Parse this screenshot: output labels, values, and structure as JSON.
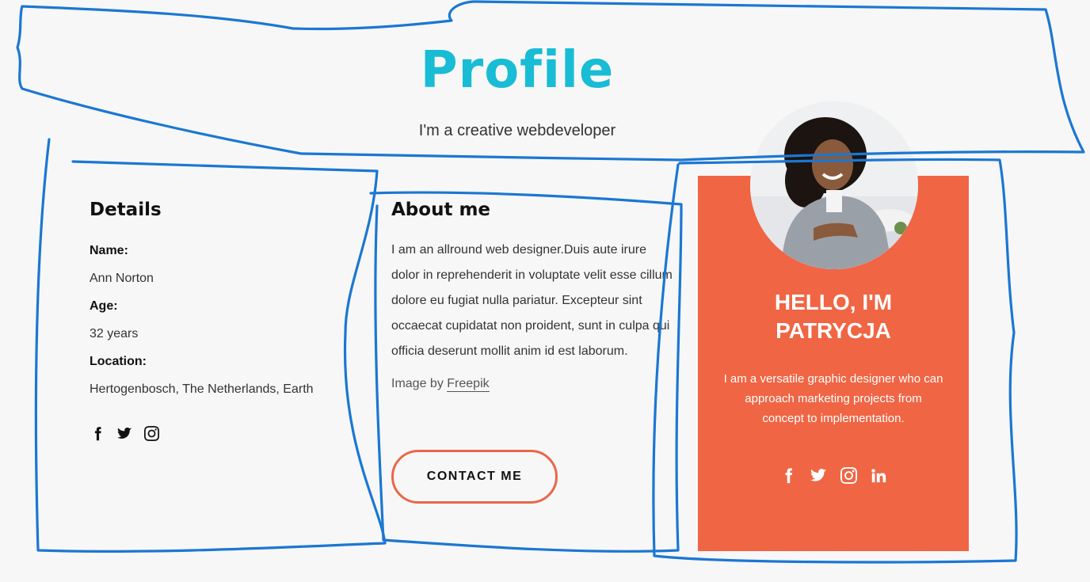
{
  "header": {
    "title": "Profile",
    "subtitle": "I'm a creative webdeveloper"
  },
  "details": {
    "heading": "Details",
    "name_label": "Name:",
    "name_value": "Ann Norton",
    "age_label": "Age:",
    "age_value": "32 years",
    "location_label": "Location:",
    "location_value": "Hertogenbosch, The Netherlands, Earth",
    "social_icons": [
      "facebook-icon",
      "twitter-icon",
      "instagram-icon"
    ]
  },
  "about": {
    "heading": "About me",
    "text": "I am an allround web designer.Duis aute irure dolor in reprehenderit in voluptate velit esse cillum dolore eu fugiat nulla pariatur. Excepteur sint occaecat cupidatat non proident, sunt in culpa qui officia deserunt mollit anim id est laborum.",
    "credit_prefix": "Image by ",
    "credit_link": "Freepik",
    "contact_button": "CONTACT ME"
  },
  "card": {
    "title_line1": "HELLO, I'M",
    "title_line2": "PATRYCJA",
    "text": "I am a versatile graphic designer who can approach marketing projects from concept to implementation.",
    "social_icons": [
      "facebook-icon",
      "twitter-icon",
      "instagram-icon",
      "linkedin-icon"
    ]
  },
  "colors": {
    "title": "#18bcd4",
    "card_background": "#f06544",
    "button_border": "#e9674a",
    "annotation_stroke": "#1b77d2",
    "page_background": "#f7f7f7"
  }
}
